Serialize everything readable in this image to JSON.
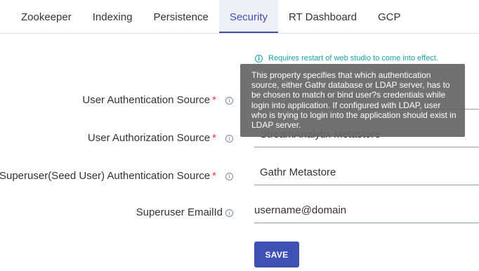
{
  "tabs": [
    {
      "label": "Zookeeper"
    },
    {
      "label": "Indexing"
    },
    {
      "label": "Persistence"
    },
    {
      "label": "Security"
    },
    {
      "label": "RT Dashboard"
    },
    {
      "label": "GCP"
    }
  ],
  "notice": {
    "icon": "info-icon",
    "text": "Requires restart of web studio to come into effect."
  },
  "form": {
    "fields": [
      {
        "label": "User Authentication Source",
        "required": "*",
        "value": ""
      },
      {
        "label": "User Authorization Source",
        "required": "*",
        "value": "StreamAnalytix Metastore"
      },
      {
        "label": "Superuser(Seed User) Authentication Source",
        "required": "*",
        "value": "Gathr Metastore"
      },
      {
        "label": "Superuser EmailId",
        "required": "",
        "value": "username@domain"
      }
    ],
    "save_label": "SAVE"
  },
  "tooltip": {
    "text": "This property specifies that which authentication source, either Gathr database or LDAP server, has to be chosen to match or bind user?s credentials while login into application. If configured with LDAP, user who is trying to login into the application should exist in LDAP server."
  },
  "colors": {
    "accent": "#3f51b5",
    "notice": "#1aa3a3",
    "required": "#e53935",
    "tooltip_bg": "#666666"
  }
}
